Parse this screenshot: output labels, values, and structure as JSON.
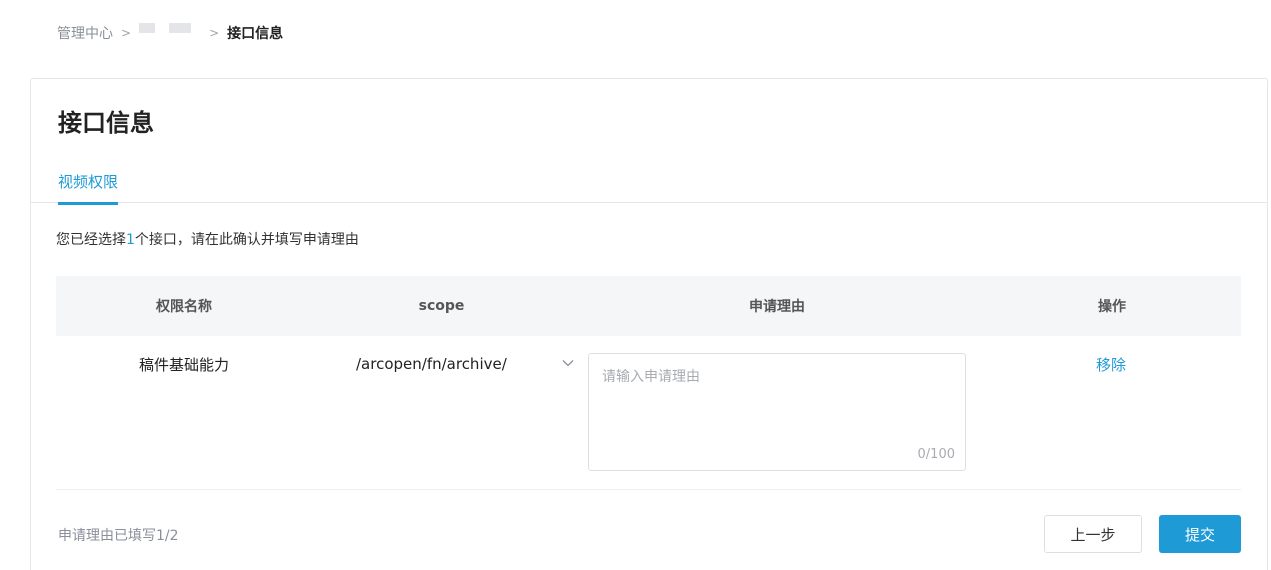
{
  "breadcrumb": {
    "root": "管理中心",
    "current": "接口信息"
  },
  "card": {
    "title": "接口信息",
    "tab_label": "视频权限"
  },
  "hint": {
    "prefix": "您已经选择",
    "count": "1",
    "suffix": "个接口，请在此确认并填写申请理由"
  },
  "table": {
    "headers": [
      "权限名称",
      "scope",
      "申请理由",
      "操作"
    ],
    "rows": [
      {
        "name": "稿件基础能力",
        "scope": "/arcopen/fn/archive/",
        "reason_value": "",
        "reason_placeholder": "请输入申请理由",
        "reason_counter": "0/100",
        "action": "移除"
      }
    ]
  },
  "footer": {
    "status": "申请理由已填写1/2",
    "prev_label": "上一步",
    "submit_label": "提交"
  },
  "colors": {
    "accent": "#1e9ad6",
    "border": "#e5e6eb"
  },
  "icons": {
    "breadcrumb_separator": "chevron-right-icon",
    "scope_dropdown": "chevron-down-icon"
  }
}
